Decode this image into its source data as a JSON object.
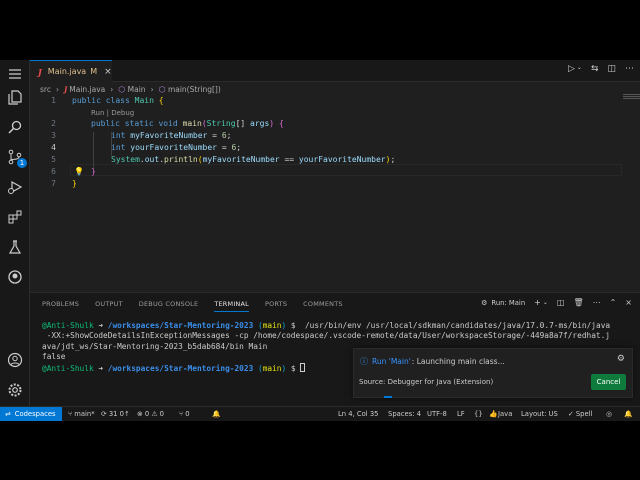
{
  "tab": {
    "file_name": "Main.java",
    "modified_flag": "M",
    "close_glyph": "×",
    "file_icon": "J"
  },
  "breadcrumb": {
    "folder": "src",
    "file": "Main.java",
    "class": "Main",
    "method": "main(String[])",
    "sep": "›"
  },
  "editor": {
    "line_numbers": [
      "1",
      "2",
      "3",
      "4",
      "5",
      "6",
      "7"
    ],
    "code_lens": "Run | Debug",
    "lines": [
      [
        "public",
        "class",
        "Main",
        "{"
      ],
      [
        "public",
        "static",
        "void",
        "main",
        "(",
        "String",
        "[]",
        "args",
        ")",
        "{"
      ],
      [
        "int",
        "myFavoriteNumber",
        "=",
        "6",
        ";"
      ],
      [
        "int",
        "yourFavoriteNumber",
        "=",
        "6",
        ";"
      ],
      [
        "System",
        ".",
        "out",
        ".",
        "println",
        "(",
        "myFavoriteNumber",
        "==",
        "yourFavoriteNumber",
        ")",
        ";"
      ],
      [
        "}"
      ],
      [
        "}"
      ]
    ]
  },
  "panel": {
    "tabs": [
      "PROBLEMS",
      "OUTPUT",
      "DEBUG CONSOLE",
      "TERMINAL",
      "PORTS",
      "COMMENTS"
    ],
    "run_label": "Run: Main"
  },
  "terminal": {
    "user": "@Anti-Shulk",
    "arrow": "➜",
    "path": "/workspaces/Star-Mentoring-2023",
    "branch_open": "(",
    "branch": "main",
    "branch_close": ")",
    "prompt": "$",
    "command_1": "/usr/bin/env /usr/local/sdkman/candidates/java/17.0.7-ms/bin/java",
    "command_2": " -XX:+ShowCodeDetailsInExceptionMessages -cp /home/codespace/.vscode-remote/data/User/workspaceStorage/-449a8a7f/redhat.j",
    "command_3": "ava/jdt_ws/Star-Mentoring-2023_b5dab684/bin Main",
    "output": "false"
  },
  "notification": {
    "run_prefix": "Run 'Main'",
    "message": ": Launching main class...",
    "source": "Source: Debugger for Java (Extension)",
    "cancel_label": "Cancel"
  },
  "status": {
    "remote": "Codespaces",
    "branch": "main*",
    "sync": "31 0↑",
    "errors": "0",
    "warnings": "0",
    "ports": "0",
    "position": "Ln 4, Col 35",
    "spaces": "Spaces: 4",
    "encoding": "UTF-8",
    "eol": "LF",
    "language": "Java",
    "layout": "Layout: US",
    "spell": "Spell"
  },
  "colors": {
    "accent": "#0078d4",
    "cancel_button": "#0e7a3b",
    "modified": "#e2c08d"
  }
}
